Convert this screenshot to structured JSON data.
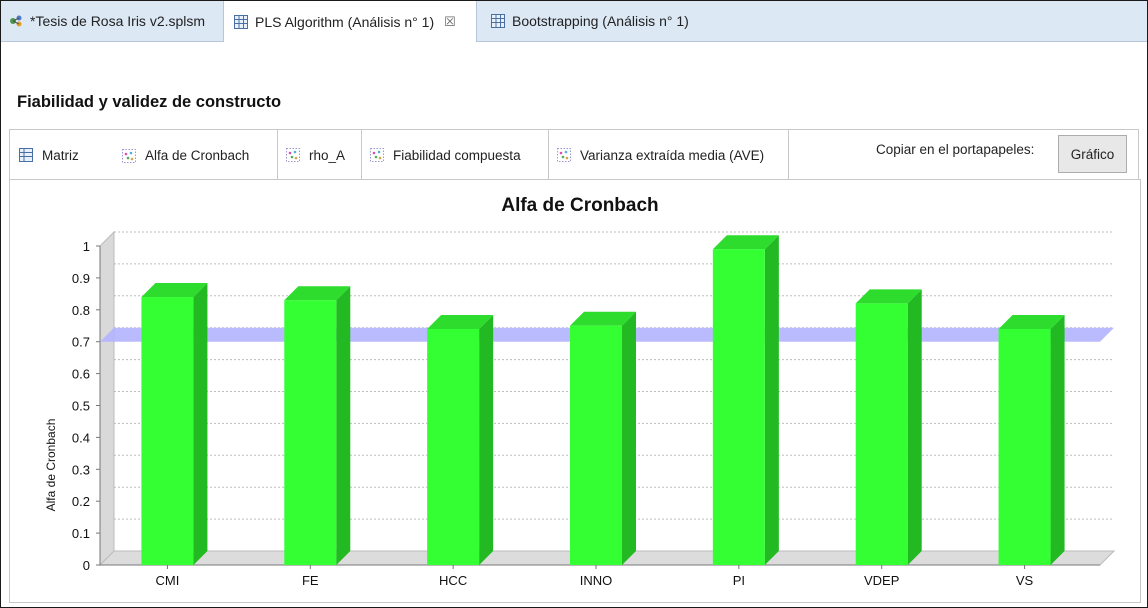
{
  "tabs": [
    {
      "label": "*Tesis de Rosa Iris v2.splsm",
      "icon": "project-icon"
    },
    {
      "label": "PLS Algorithm (Análisis n° 1)",
      "icon": "grid-icon",
      "close": "☒"
    },
    {
      "label": "Bootstrapping (Análisis n° 1)",
      "icon": "grid-icon"
    }
  ],
  "section_title": "Fiabilidad y validez de constructo",
  "subtabs": [
    {
      "label": "Matriz",
      "icon": "grid-icon"
    },
    {
      "label": "Alfa de Cronbach",
      "icon": "chart-dots-icon"
    },
    {
      "label": "rho_A",
      "icon": "chart-dots-icon"
    },
    {
      "label": "Fiabilidad compuesta",
      "icon": "chart-dots-icon"
    },
    {
      "label": "Varianza extraída media (AVE)",
      "icon": "chart-dots-icon"
    }
  ],
  "copy_label": "Copiar en el portapapeles:",
  "graph_button": "Gráfico",
  "colors": {
    "bar": "#33ff33",
    "bar_side": "#22b922",
    "threshold": "#b3b3ff",
    "topbar": "#dde8f5"
  },
  "chart_data": {
    "type": "bar",
    "title": "Alfa de Cronbach",
    "xlabel": "",
    "ylabel": "Alfa de Cronbach",
    "categories": [
      "CMI",
      "FE",
      "HCC",
      "INNO",
      "PI",
      "VDEP",
      "VS"
    ],
    "values": [
      0.84,
      0.83,
      0.74,
      0.75,
      0.99,
      0.82,
      0.74
    ],
    "threshold": 0.7,
    "ylim": [
      0,
      1
    ],
    "yticks": [
      "0",
      "0.1",
      "0.2",
      "0.3",
      "0.4",
      "0.5",
      "0.6",
      "0.7",
      "0.8",
      "0.9",
      "1"
    ],
    "grid": true
  }
}
